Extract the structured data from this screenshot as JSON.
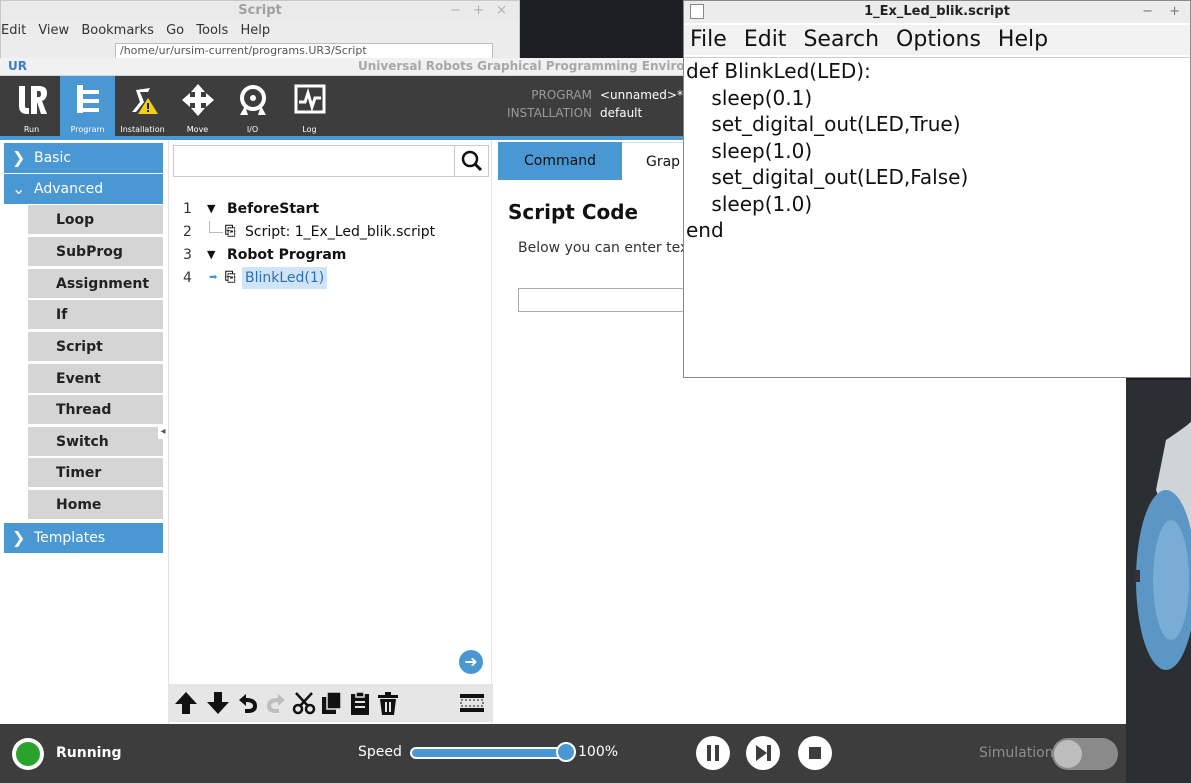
{
  "file_manager": {
    "title": "Script",
    "window_controls": "− + ×",
    "menu": [
      "Edit",
      "View",
      "Bookmarks",
      "Go",
      "Tools",
      "Help"
    ],
    "path": "/home/ur/ursim-current/programs.UR3/Script"
  },
  "ur_window": {
    "title": "Universal Robots Graphical Programming Environment",
    "logo": "UR",
    "nav": [
      {
        "label": "Run",
        "icon": "ur-logo-icon"
      },
      {
        "label": "Program",
        "icon": "program-tree-icon"
      },
      {
        "label": "Installation",
        "icon": "installation-warning-icon"
      },
      {
        "label": "Move",
        "icon": "move-arrows-icon"
      },
      {
        "label": "I/O",
        "icon": "io-icon"
      },
      {
        "label": "Log",
        "icon": "log-chart-icon"
      }
    ],
    "program_label": "PROGRAM",
    "program_value": "<unnamed>*",
    "installation_label": "INSTALLATION",
    "installation_value": "default"
  },
  "sidebar": {
    "basic": "Basic",
    "advanced": "Advanced",
    "items": [
      "Loop",
      "SubProg",
      "Assignment",
      "If",
      "Script",
      "Event",
      "Thread",
      "Switch",
      "Timer",
      "Home"
    ],
    "templates": "Templates"
  },
  "tree": {
    "rows": [
      {
        "num": "1",
        "label": "BeforeStart"
      },
      {
        "num": "2",
        "label": "Script: 1_Ex_Led_blik.script"
      },
      {
        "num": "3",
        "label": "Robot Program"
      },
      {
        "num": "4",
        "label": "BlinkLed(1)"
      }
    ]
  },
  "content": {
    "tab_command": "Command",
    "tab_graphics": "Grap",
    "heading": "Script Code",
    "description": "Below you can enter tex"
  },
  "status": {
    "state": "Running",
    "speed_label": "Speed",
    "speed_value": "100%",
    "speed_fraction": 1.0,
    "simulation_label": "Simulation",
    "accent": "#4a98d3",
    "running_color": "#2aa32a"
  },
  "editor": {
    "title": "1_Ex_Led_blik.script",
    "window_controls": "− +",
    "menu": [
      "File",
      "Edit",
      "Search",
      "Options",
      "Help"
    ],
    "lines": [
      "def BlinkLed(LED):",
      "    sleep(0.1)",
      "    set_digital_out(LED,True)",
      "    sleep(1.0)",
      "    set_digital_out(LED,False)",
      "    sleep(1.0)",
      "end"
    ]
  }
}
